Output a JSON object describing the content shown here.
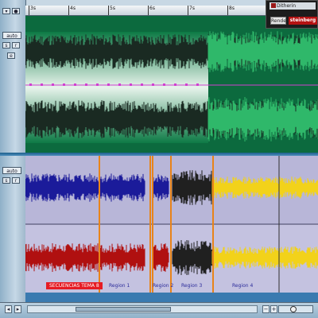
{
  "ruler": {
    "ticks": [
      "3s",
      "4s",
      "5s",
      "6s",
      "7s",
      "8s"
    ]
  },
  "left_panel": {
    "track1_mode": "auto",
    "track2_mode": "auto"
  },
  "plugin_panel": {
    "title": "Ditherin",
    "render_label": "Render",
    "brand": "steinberg"
  },
  "markers": {
    "main_label": "SECUENCIAS TEMA 8",
    "region_labels": [
      "Region 1",
      "Region 2",
      "Region 3",
      "Region 4"
    ]
  },
  "colors": {
    "track1_bg": "#0c6a3e",
    "track1_wave": "#2fb86a",
    "track2_bg": "#b8b6d8",
    "blue_wave": "#1b1b9a",
    "red_wave": "#b01010",
    "yellow_wave": "#f2d21a",
    "marker_orange": "#e8841a",
    "envelope": "#d040d0"
  }
}
